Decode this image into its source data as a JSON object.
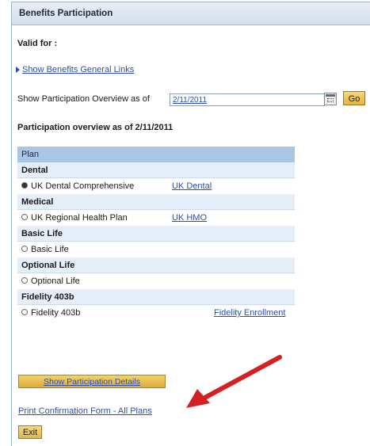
{
  "header": {
    "title": "Benefits Participation"
  },
  "valid_for": {
    "label": "Valid for :"
  },
  "links": {
    "general_links": "Show Benefits General Links"
  },
  "overview": {
    "label": "Show Participation Overview as of",
    "date_value": "2/11/2011",
    "go_label": "Go",
    "heading": "Participation overview as of 2/11/2011"
  },
  "table": {
    "header": "Plan",
    "categories": [
      {
        "name": "Dental",
        "option": "UK Dental Comprehensive",
        "link": "UK Dental",
        "selected": true
      },
      {
        "name": "Medical",
        "option": "UK Regional Health Plan",
        "link": "UK HMO",
        "selected": false
      },
      {
        "name": "Basic Life",
        "option": "Basic Life",
        "link": "",
        "selected": false
      },
      {
        "name": "Optional Life",
        "option": "Optional Life",
        "link": "",
        "selected": false
      },
      {
        "name": "Fidelity 403b",
        "option": "Fidelity 403b",
        "link": "Fidelity Enrollment",
        "selected": false
      }
    ]
  },
  "actions": {
    "details_label": "Show Participation Details",
    "print_label": "Print Confirmation Form - All Plans",
    "exit_label": "Exit"
  },
  "colors": {
    "annotation_arrow": "#d42020",
    "link": "#2a4fb0",
    "header_row": "#a9c6e4"
  }
}
